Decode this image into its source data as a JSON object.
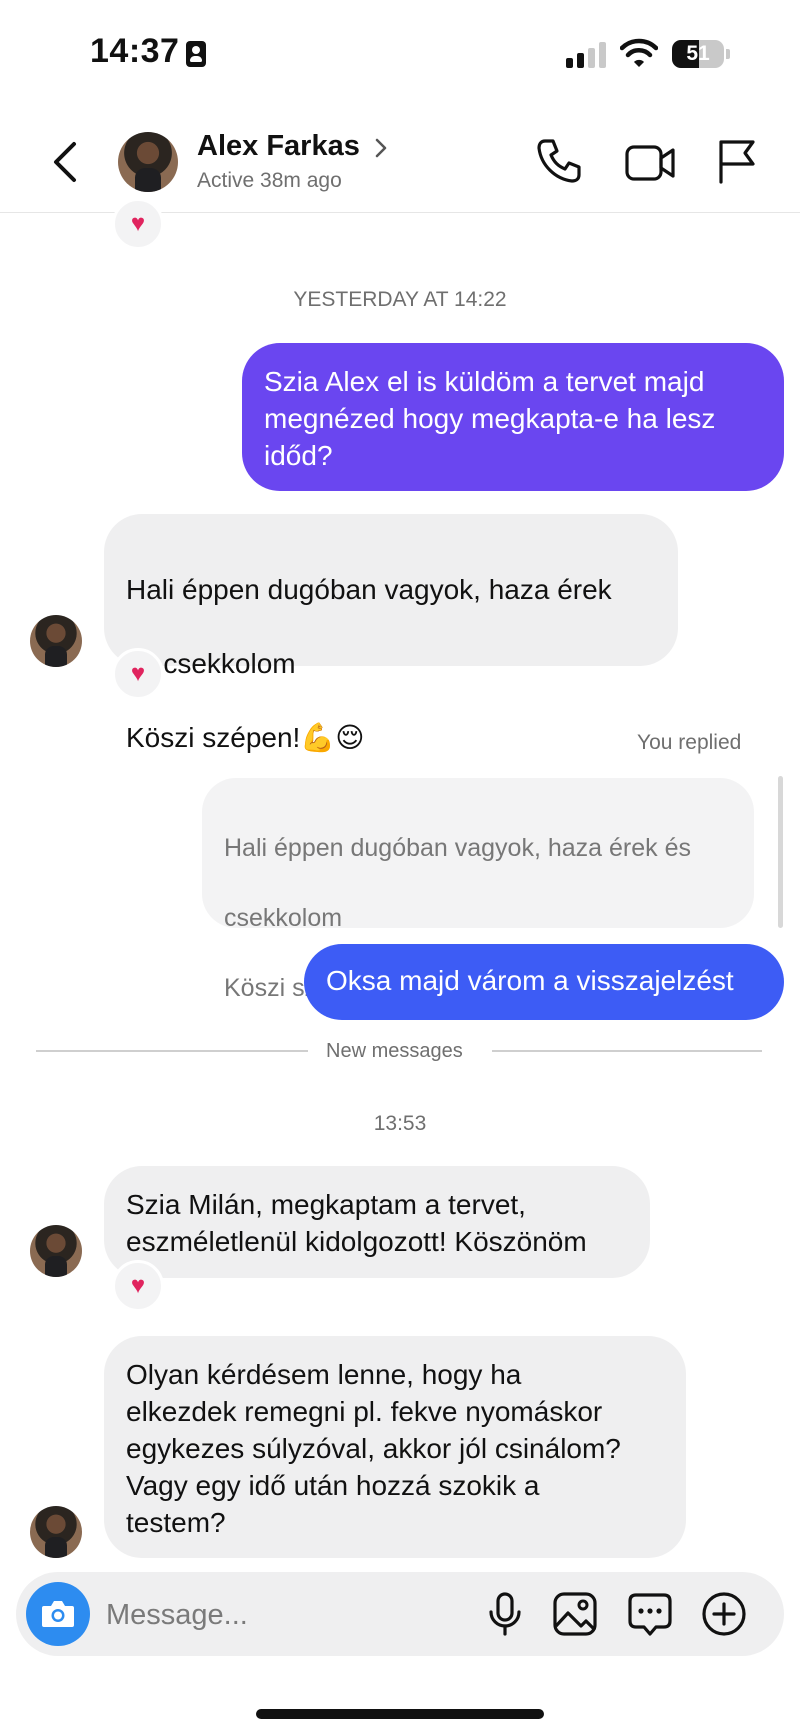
{
  "status_bar": {
    "time": "14:37",
    "battery": "51",
    "battery_level": 0.51
  },
  "header": {
    "contact_name": "Alex Farkas",
    "contact_status": "Active 38m ago"
  },
  "messages": {
    "top_reaction": "♥",
    "ts_yesterday": "YESTERDAY AT 14:22",
    "out_1": "Szia Alex el is küldöm a tervet majd megnézed hogy megkapta-e ha lesz időd?",
    "in_1_line1": "Hali éppen dugóban vagyok, haza érek",
    "in_1_line2": "és csekkolom",
    "in_1_line3": "Köszi szépen!",
    "in_1_emojis": "💪😌",
    "in_1_reaction": "♥",
    "you_replied": "You replied",
    "quote_line1": "Hali éppen dugóban vagyok, haza érek és",
    "quote_line2": "csekkolom",
    "quote_line3": "Köszi szépen!",
    "quote_emojis": "💪😌",
    "out_2": "Oksa majd várom a visszajelzést",
    "new_messages": "New messages",
    "ts_today": "13:53",
    "in_2": "Szia Milán, megkaptam a tervet,\neszméletlenül kidolgozott! Köszönöm",
    "in_2_reaction": "♥",
    "in_3": "Olyan kérdésem lenne, hogy ha\nelkezdek remegni pl. fekve nyomáskor\negykezes súlyzóval, akkor jól csinálom?\nVagy egy idő után hozzá szokik a\ntestem?"
  },
  "composer": {
    "placeholder": "Message..."
  },
  "icons": {
    "back": "chevron-left-icon",
    "call": "phone-icon",
    "video": "video-camera-icon",
    "flag": "flag-icon",
    "camera": "camera-icon",
    "mic": "microphone-icon",
    "gallery": "image-icon",
    "sticker": "chat-bubble-icon",
    "more": "plus-circle-icon"
  },
  "colors": {
    "outgoing_purple": "#6a46f0",
    "outgoing_blue": "#3d5cf5",
    "incoming": "#efeff0",
    "camera_button": "#2d8cf0"
  }
}
